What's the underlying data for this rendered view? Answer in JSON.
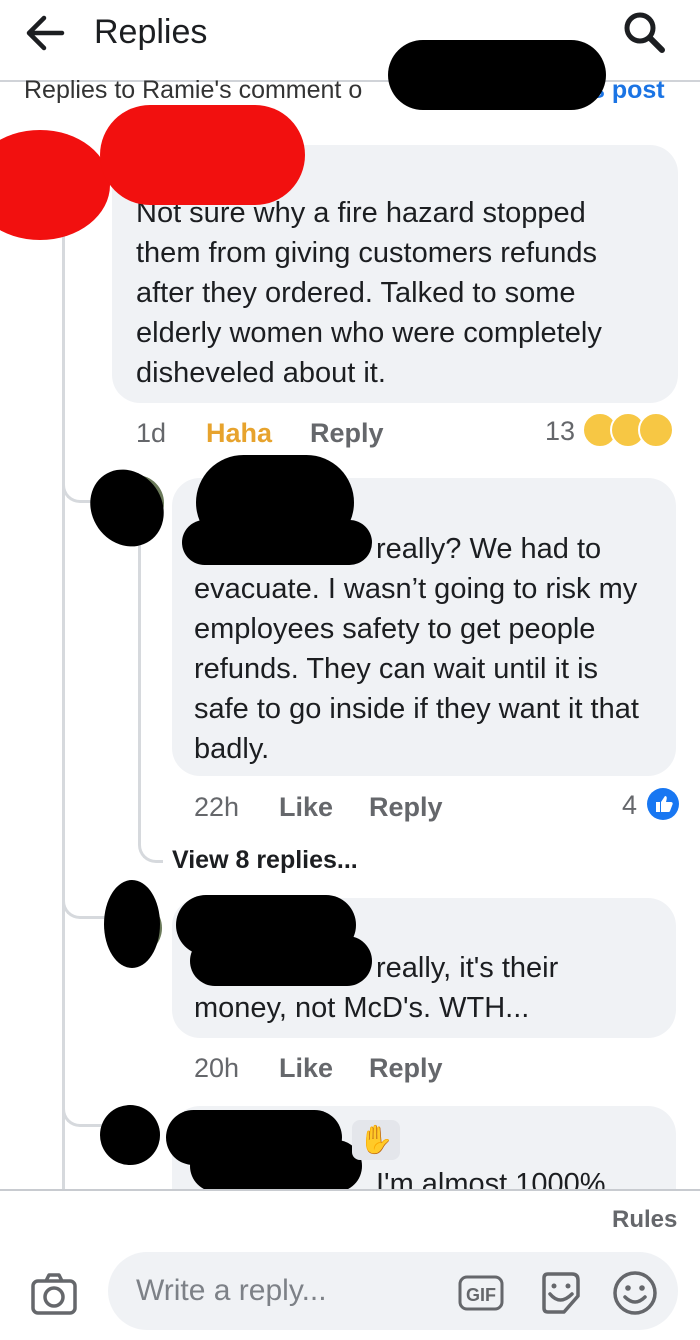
{
  "header": {
    "title": "Replies",
    "subtitle_prefix": "Replies to Ramie's comment o",
    "subtitle_suffix": "s post"
  },
  "comments": [
    {
      "text": "Not sure why a fire hazard stopped them from giving customers refunds after they ordered. Talked to some elderly women who were completely disheveled about it.",
      "time": "1d",
      "reaction_label": "Haha",
      "reply_label": "Reply",
      "reaction_count": "13",
      "reaction_icons": [
        "laughing-emoji-icon",
        "wow-emoji-icon",
        "sad-emoji-icon"
      ]
    },
    {
      "text": "really? We had to evacuate. I wasn’t going to risk my employees safety to get people refunds. They can wait until it is safe to go inside if they want it that badly.",
      "time": "22h",
      "like_label": "Like",
      "reply_label": "Reply",
      "reaction_count": "4",
      "reaction_icons": [
        "thumbs-up-icon"
      ]
    },
    {
      "text": "really,  it's their money,  not McD's. WTH...",
      "time": "20h",
      "like_label": "Like",
      "reply_label": "Reply"
    },
    {
      "text": "I'm almost 1000%"
    }
  ],
  "view_replies": "View 8 replies...",
  "footer": {
    "rules": "Rules",
    "reply_placeholder": "Write a reply...",
    "gif_label": "GIF"
  },
  "colors": {
    "link": "#1b74e4",
    "haha": "#e7a32d",
    "like_blue": "#1877f2",
    "bubble": "#f0f2f5",
    "meta": "#65676b"
  }
}
